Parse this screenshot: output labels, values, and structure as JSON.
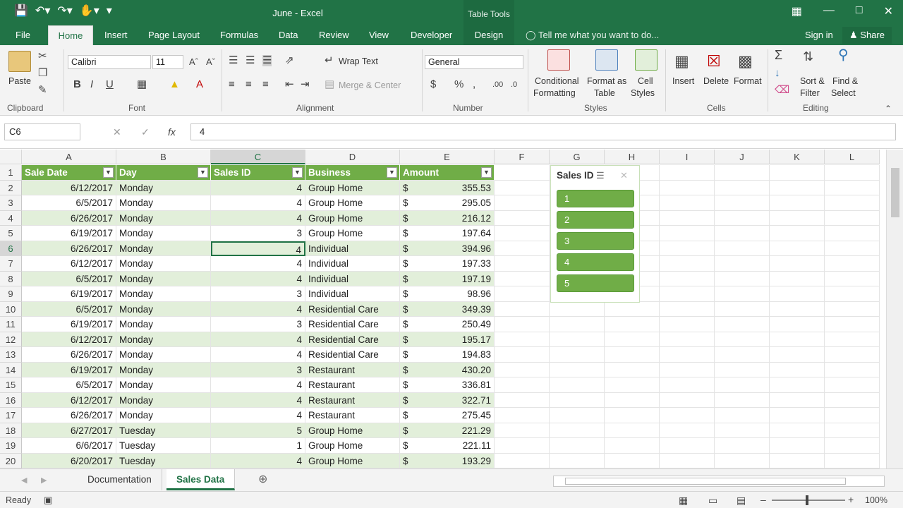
{
  "window": {
    "title": "June - Excel",
    "contextual_tab_group": "Table Tools"
  },
  "tabs": [
    "File",
    "Home",
    "Insert",
    "Page Layout",
    "Formulas",
    "Data",
    "Review",
    "View",
    "Developer",
    "Design"
  ],
  "tell_me": "Tell me what you want to do...",
  "account": {
    "sign_in": "Sign in",
    "share": "Share"
  },
  "ribbon": {
    "clipboard": {
      "label": "Clipboard",
      "paste": "Paste"
    },
    "font": {
      "label": "Font",
      "name": "Calibri",
      "size": "11"
    },
    "alignment": {
      "label": "Alignment",
      "wrap": "Wrap Text",
      "merge": "Merge & Center"
    },
    "number": {
      "label": "Number",
      "format": "General"
    },
    "styles": {
      "label": "Styles",
      "cond1": "Conditional",
      "cond2": "Formatting",
      "fmt1": "Format as",
      "fmt2": "Table",
      "cell1": "Cell",
      "cell2": "Styles"
    },
    "cells": {
      "label": "Cells",
      "insert": "Insert",
      "delete": "Delete",
      "format": "Format"
    },
    "editing": {
      "label": "Editing",
      "sort1": "Sort &",
      "sort2": "Filter",
      "find1": "Find &",
      "find2": "Select"
    }
  },
  "formula_bar": {
    "name_box": "C6",
    "value": "4"
  },
  "columns": [
    "A",
    "B",
    "C",
    "D",
    "E",
    "F",
    "G",
    "H",
    "I",
    "J",
    "K",
    "L"
  ],
  "table": {
    "headers": [
      "Sale Date",
      "Day",
      "Sales ID",
      "Business",
      "Amount"
    ],
    "rows": [
      [
        "6/12/2017",
        "Monday",
        "4",
        "Group Home",
        "$",
        "355.53"
      ],
      [
        "6/5/2017",
        "Monday",
        "4",
        "Group Home",
        "$",
        "295.05"
      ],
      [
        "6/26/2017",
        "Monday",
        "4",
        "Group Home",
        "$",
        "216.12"
      ],
      [
        "6/19/2017",
        "Monday",
        "3",
        "Group Home",
        "$",
        "197.64"
      ],
      [
        "6/26/2017",
        "Monday",
        "4",
        "Individual",
        "$",
        "394.96"
      ],
      [
        "6/12/2017",
        "Monday",
        "4",
        "Individual",
        "$",
        "197.33"
      ],
      [
        "6/5/2017",
        "Monday",
        "4",
        "Individual",
        "$",
        "197.19"
      ],
      [
        "6/19/2017",
        "Monday",
        "3",
        "Individual",
        "$",
        "98.96"
      ],
      [
        "6/5/2017",
        "Monday",
        "4",
        "Residential Care",
        "$",
        "349.39"
      ],
      [
        "6/19/2017",
        "Monday",
        "3",
        "Residential Care",
        "$",
        "250.49"
      ],
      [
        "6/12/2017",
        "Monday",
        "4",
        "Residential Care",
        "$",
        "195.17"
      ],
      [
        "6/26/2017",
        "Monday",
        "4",
        "Residential Care",
        "$",
        "194.83"
      ],
      [
        "6/19/2017",
        "Monday",
        "3",
        "Restaurant",
        "$",
        "430.20"
      ],
      [
        "6/5/2017",
        "Monday",
        "4",
        "Restaurant",
        "$",
        "336.81"
      ],
      [
        "6/12/2017",
        "Monday",
        "4",
        "Restaurant",
        "$",
        "322.71"
      ],
      [
        "6/26/2017",
        "Monday",
        "4",
        "Restaurant",
        "$",
        "275.45"
      ],
      [
        "6/27/2017",
        "Tuesday",
        "5",
        "Group Home",
        "$",
        "221.29"
      ],
      [
        "6/6/2017",
        "Tuesday",
        "1",
        "Group Home",
        "$",
        "221.11"
      ],
      [
        "6/20/2017",
        "Tuesday",
        "4",
        "Group Home",
        "$",
        "193.29"
      ]
    ]
  },
  "selected_cell": {
    "row": 6,
    "col": "C"
  },
  "slicer": {
    "title": "Sales ID",
    "items": [
      "1",
      "2",
      "3",
      "4",
      "5"
    ]
  },
  "sheets": [
    "Documentation",
    "Sales Data"
  ],
  "active_sheet": "Sales Data",
  "status": {
    "mode": "Ready",
    "zoom": "100%"
  },
  "colors": {
    "excel_green": "#217346",
    "table_header": "#70ad47",
    "band": "#e2efda"
  }
}
